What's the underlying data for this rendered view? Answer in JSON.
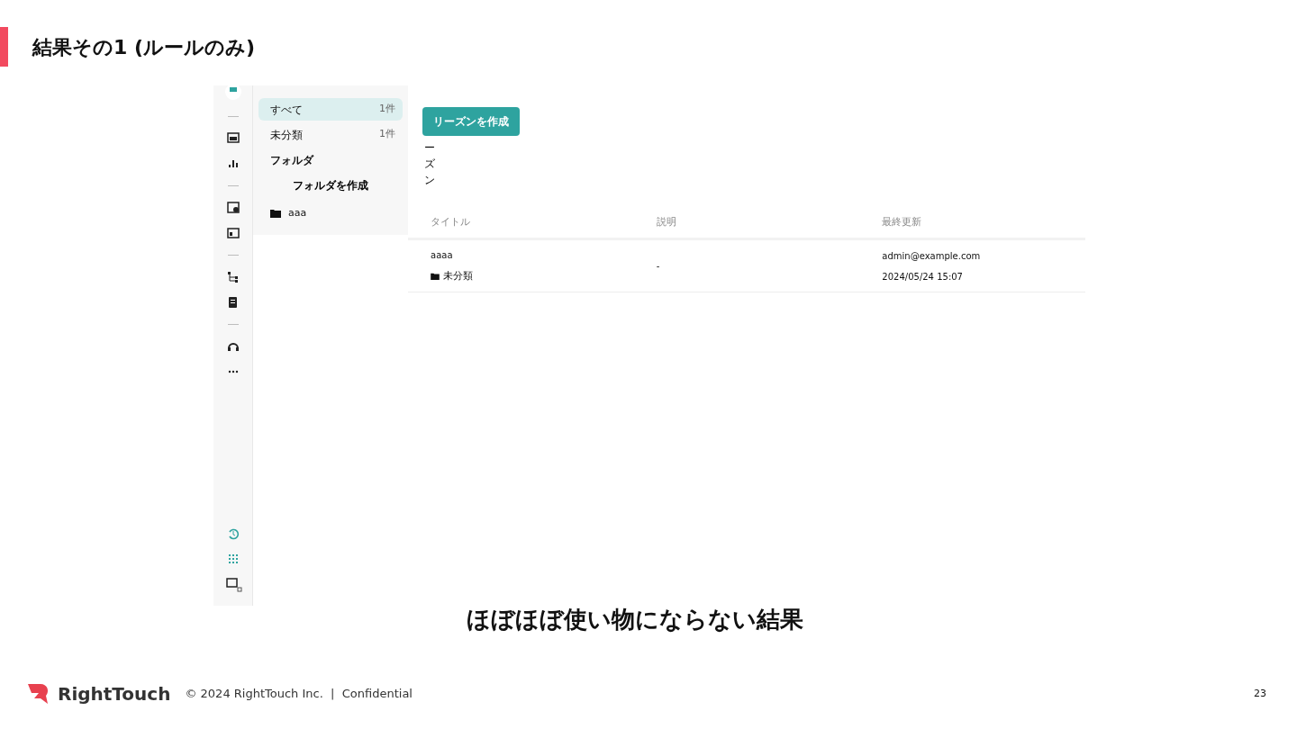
{
  "slide": {
    "title": "結果その1 (ルールのみ)",
    "caption": "ほぼほぼ使い物にならない結果",
    "page_number": "23"
  },
  "footer": {
    "brand": "RightTouch",
    "copyright": "© 2024 RightTouch Inc.  |  Confidential"
  },
  "app": {
    "filters": [
      {
        "label": "すべて",
        "count": "1件",
        "selected": true
      },
      {
        "label": "未分類",
        "count": "1件",
        "selected": false
      }
    ],
    "folder_heading": "フォルダ",
    "create_folder_button": "フォルダを作成",
    "folders": [
      {
        "name": "aaa"
      }
    ],
    "vertical_label": "ーズン",
    "create_button": "リーズンを作成",
    "table": {
      "columns": [
        "タイトル",
        "説明",
        "最終更新"
      ],
      "rows": [
        {
          "title": "aaaa",
          "folder": "未分類",
          "description": "-",
          "updated_by": "admin@example.com",
          "updated_at": "2024/05/24 15:07"
        }
      ]
    }
  }
}
